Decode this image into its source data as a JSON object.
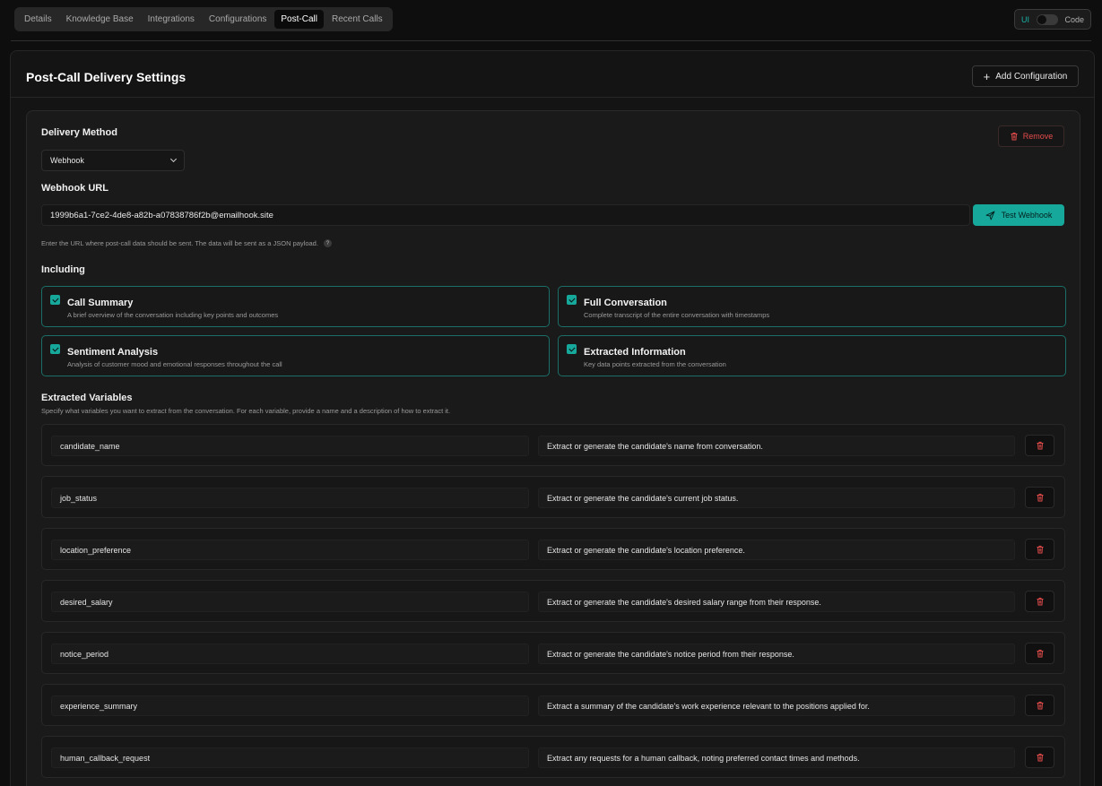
{
  "tabs": [
    "Details",
    "Knowledge Base",
    "Integrations",
    "Configurations",
    "Post-Call",
    "Recent Calls"
  ],
  "active_tab": "Post-Call",
  "mode_toggle": {
    "left": "UI",
    "right": "Code"
  },
  "card": {
    "title": "Post-Call Delivery Settings",
    "add_button": "Add Configuration"
  },
  "config": {
    "delivery_method_label": "Delivery Method",
    "delivery_method_value": "Webhook",
    "remove_label": "Remove",
    "webhook_url_label": "Webhook URL",
    "webhook_url_value": "1999b6a1-7ce2-4de8-a82b-a07838786f2b@emailhook.site",
    "test_button": "Test Webhook",
    "hint": "Enter the URL where post-call data should be sent. The data will be sent as a JSON payload.",
    "hint_icon": "?",
    "including_label": "Including",
    "options": [
      {
        "title": "Call Summary",
        "desc": "A brief overview of the conversation including key points and outcomes",
        "checked": true
      },
      {
        "title": "Full Conversation",
        "desc": "Complete transcript of the entire conversation with timestamps",
        "checked": true
      },
      {
        "title": "Sentiment Analysis",
        "desc": "Analysis of customer mood and emotional responses throughout the call",
        "checked": true
      },
      {
        "title": "Extracted Information",
        "desc": "Key data points extracted from the conversation",
        "checked": true
      }
    ],
    "extracted_label": "Extracted Variables",
    "extracted_desc": "Specify what variables you want to extract from the conversation. For each variable, provide a name and a description of how to extract it.",
    "variables": [
      {
        "name": "candidate_name",
        "desc": "Extract or generate the candidate's name from conversation."
      },
      {
        "name": "job_status",
        "desc": "Extract or generate the candidate's current job status."
      },
      {
        "name": "location_preference",
        "desc": "Extract or generate the candidate's location preference."
      },
      {
        "name": "desired_salary",
        "desc": "Extract or generate the candidate's desired salary range from their response."
      },
      {
        "name": "notice_period",
        "desc": "Extract or generate the candidate's notice period from their response."
      },
      {
        "name": "experience_summary",
        "desc": "Extract a summary of the candidate's work experience relevant to the positions applied for."
      },
      {
        "name": "human_callback_request",
        "desc": "Extract any requests for a human callback, noting preferred contact times and methods."
      }
    ]
  },
  "colors": {
    "accent": "#17a89c",
    "danger": "#e44c4c"
  }
}
